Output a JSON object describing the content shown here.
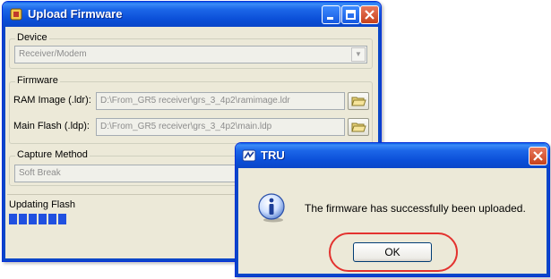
{
  "main_window": {
    "title": "Upload Firmware",
    "device": {
      "group_label": "Device",
      "selected": "Receiver/Modem"
    },
    "firmware": {
      "group_label": "Firmware",
      "ram_image_label": "RAM Image (.ldr):",
      "ram_image_path": "D:\\From_GR5 receiver\\grs_3_4p2\\ramimage.ldr",
      "main_flash_label": "Main Flash (.ldp):",
      "main_flash_path": "D:\\From_GR5 receiver\\grs_3_4p2\\main.ldp"
    },
    "capture": {
      "group_label": "Capture Method",
      "selected": "Soft Break"
    },
    "status": {
      "label": "Updating Flash",
      "progress_blocks": 6
    }
  },
  "dialog": {
    "title": "TRU",
    "message": "The firmware has successfully been uploaded.",
    "ok_label": "OK"
  },
  "colors": {
    "titlebar": "#0a46c8",
    "highlight": "#e3322f",
    "progress": "#2050e0"
  }
}
